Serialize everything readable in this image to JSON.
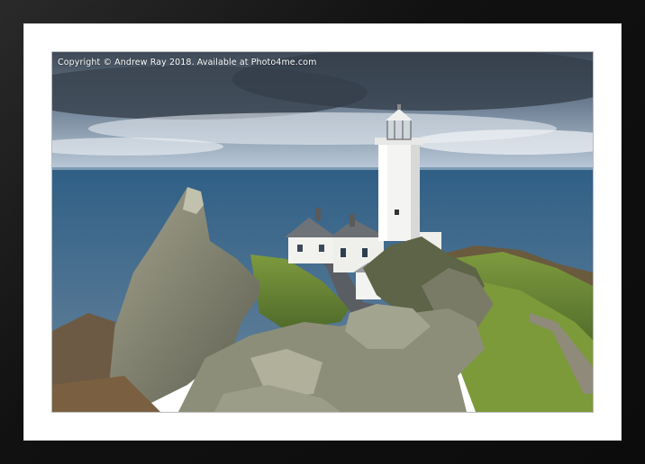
{
  "watermark": {
    "text": "Copyright © Andrew Ray 2018. Available at Photo4me.com"
  },
  "colors": {
    "frame": "#111111",
    "mat": "#ffffff",
    "sky": "#8fa3b8",
    "sea": "#4f6f8c",
    "grass": "#6f8f3a",
    "rock": "#8a8a7a",
    "lighthouse": "#f2f2f0"
  }
}
